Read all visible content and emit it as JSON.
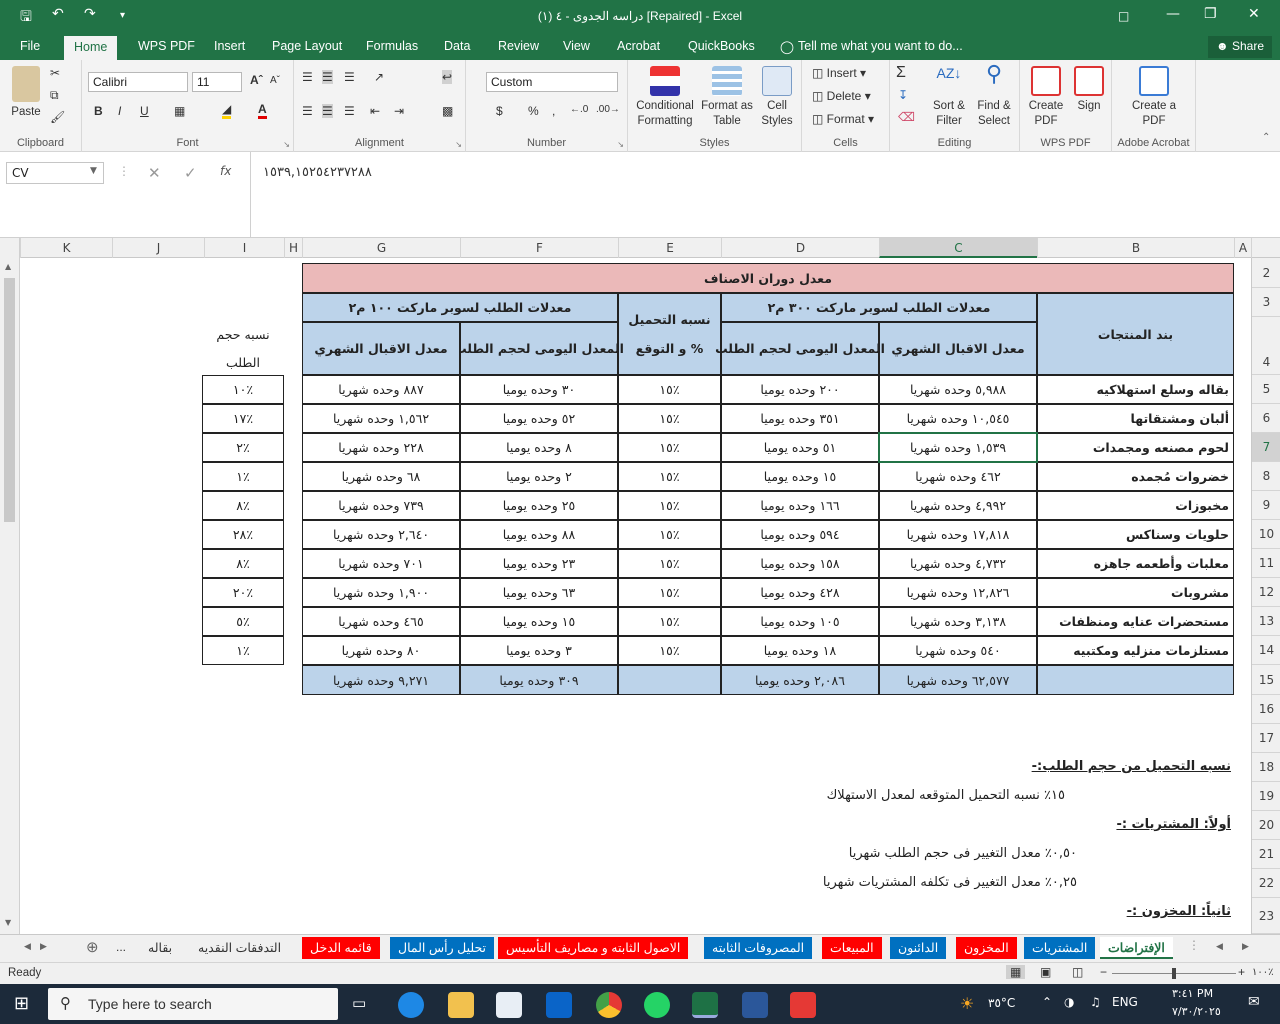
{
  "window": {
    "title": "دراسه الجدوى - ٤ (١) [Repaired] - Excel"
  },
  "menu": [
    "File",
    "Home",
    "WPS PDF",
    "Insert",
    "Page Layout",
    "Formulas",
    "Data",
    "Review",
    "View",
    "Acrobat",
    "QuickBooks",
    "Tell me what you want to do...",
    "Share"
  ],
  "ribbon": {
    "clipboard": {
      "paste": "Paste",
      "label": "Clipboard"
    },
    "font": {
      "name": "Calibri",
      "size": "11",
      "label": "Font"
    },
    "alignment": {
      "label": "Alignment"
    },
    "number": {
      "format": "Custom",
      "label": "Number"
    },
    "styles": {
      "conditional": "Conditional Formatting",
      "format_table": "Format as Table",
      "cell_styles": "Cell Styles",
      "label": "Styles"
    },
    "cells": {
      "insert": "Insert",
      "delete": "Delete",
      "format": "Format",
      "label": "Cells"
    },
    "editing": {
      "sort": "Sort & Filter",
      "find": "Find & Select",
      "label": "Editing"
    },
    "wpspdf": {
      "create": "Create PDF",
      "sign": "Sign",
      "label": "WPS PDF"
    },
    "acrobat": {
      "create": "Create a PDF",
      "label": "Adobe Acrobat"
    }
  },
  "formula_bar": {
    "name_box": "CV",
    "formula": "١٥٣٩,١٥٢٥٤٢٣٧٢٨٨"
  },
  "columns": [
    "K",
    "J",
    "I",
    "H",
    "G",
    "F",
    "E",
    "D",
    "C",
    "B",
    "A"
  ],
  "rows": [
    "2",
    "3",
    "4",
    "5",
    "6",
    "7",
    "8",
    "9",
    "10",
    "11",
    "12",
    "13",
    "14",
    "15",
    "16",
    "17",
    "18",
    "19",
    "20",
    "21",
    "22",
    "23"
  ],
  "table": {
    "title": "معدل دوران الاصناف",
    "group300": "معدلات الطلب لسوبر ماركت ٣٠٠ م٢",
    "group100": "معدلات الطلب لسوبر ماركت ١٠٠ م٢",
    "load_header": "نسبه التحميل و التوقع %",
    "products_header": "بند المنتجات",
    "monthly_header": "معدل الاقبال الشهري",
    "daily_header": "المعدل اليومى لحجم الطلب",
    "share_header": "نسبه حجم الطلب",
    "rows": [
      {
        "product": "بقاله وسلع استهلاكيه",
        "c": "٥,٩٨٨  وحده شهريا",
        "d": "٢٠٠  وحده يوميا",
        "e": "١٥٪",
        "f": "٣٠  وحده يوميا",
        "g": "٨٨٧  وحده شهريا",
        "i": "١٠٪"
      },
      {
        "product": "ألبان ومشتقاتها",
        "c": "١٠,٥٤٥  وحده شهريا",
        "d": "٣٥١  وحده يوميا",
        "e": "١٥٪",
        "f": "٥٢  وحده يوميا",
        "g": "١,٥٦٢  وحده شهريا",
        "i": "١٧٪"
      },
      {
        "product": "لحوم مصنعه ومجمدات",
        "c": "١,٥٣٩  وحده شهريا",
        "d": "٥١  وحده يوميا",
        "e": "١٥٪",
        "f": "٨  وحده يوميا",
        "g": "٢٢٨  وحده شهريا",
        "i": "٢٪"
      },
      {
        "product": "خضروات مُجمده",
        "c": "٤٦٢  وحده شهريا",
        "d": "١٥  وحده يوميا",
        "e": "١٥٪",
        "f": "٢  وحده يوميا",
        "g": "٦٨  وحده شهريا",
        "i": "١٪"
      },
      {
        "product": "مخبوزات",
        "c": "٤,٩٩٢  وحده شهريا",
        "d": "١٦٦  وحده يوميا",
        "e": "١٥٪",
        "f": "٢٥  وحده يوميا",
        "g": "٧٣٩  وحده شهريا",
        "i": "٨٪"
      },
      {
        "product": "حلويات وسناكس",
        "c": "١٧,٨١٨  وحده شهريا",
        "d": "٥٩٤  وحده يوميا",
        "e": "١٥٪",
        "f": "٨٨  وحده يوميا",
        "g": "٢,٦٤٠  وحده شهريا",
        "i": "٢٨٪"
      },
      {
        "product": "معلبات وأطعمه جاهزه",
        "c": "٤,٧٣٢  وحده شهريا",
        "d": "١٥٨  وحده يوميا",
        "e": "١٥٪",
        "f": "٢٣  وحده يوميا",
        "g": "٧٠١  وحده شهريا",
        "i": "٨٪"
      },
      {
        "product": "مشروبات",
        "c": "١٢,٨٢٦  وحده شهريا",
        "d": "٤٢٨  وحده يوميا",
        "e": "١٥٪",
        "f": "٦٣  وحده يوميا",
        "g": "١,٩٠٠  وحده شهريا",
        "i": "٢٠٪"
      },
      {
        "product": "مستحضرات عنايه ومنظفات",
        "c": "٣,١٣٨  وحده شهريا",
        "d": "١٠٥  وحده يوميا",
        "e": "١٥٪",
        "f": "١٥  وحده يوميا",
        "g": "٤٦٥  وحده شهريا",
        "i": "٥٪"
      },
      {
        "product": "مستلزمات منزليه ومكتبيه",
        "c": "٥٤٠  وحده شهريا",
        "d": "١٨  وحده يوميا",
        "e": "١٥٪",
        "f": "٣  وحده يوميا",
        "g": "٨٠  وحده شهريا",
        "i": "١٪"
      }
    ],
    "totals": {
      "c": "٦٢,٥٧٧  وحده شهريا",
      "d": "٢,٠٨٦  وحده يوميا",
      "f": "٣٠٩  وحده يوميا",
      "g": "٩,٢٧١  وحده شهريا"
    }
  },
  "notes": {
    "heading1": "نسبه التحميل من حجم الطلب:-",
    "line1": "١٥٪ نسبه التحميل المتوقعه لمعدل الاستهلاك",
    "heading2": "أولاً: المشتريات :-",
    "line2": "٠,٥٠٪  معدل التغيير فى حجم الطلب شهريا",
    "line3": "٠,٢٥٪  معدل التغيير فى تكلفه المشتريات شهريا",
    "heading3": "ثانياً: المخزون :-"
  },
  "sheet_tabs": [
    {
      "label": "الإفتراضات",
      "color": "#ffffff",
      "active": true
    },
    {
      "label": "المشتريات",
      "color": "#0070c0"
    },
    {
      "label": "المخزون",
      "color": "#ff0000"
    },
    {
      "label": "الدائنون",
      "color": "#0070c0"
    },
    {
      "label": "المبيعات",
      "color": "#ff0000"
    },
    {
      "label": "المصروفات الثابته",
      "color": "#0070c0"
    },
    {
      "label": "الاصول الثابته و مصاريف التأسيس",
      "color": "#ff0000"
    },
    {
      "label": "تحليل رأس المال",
      "color": "#0070c0"
    },
    {
      "label": "قائمه الدخل",
      "color": "#ff0000"
    },
    {
      "label": "التدفقات النقديه",
      "color": "none"
    },
    {
      "label": "بقاله",
      "color": "none"
    }
  ],
  "status": {
    "ready": "Ready",
    "zoom": "١٠٠٪"
  },
  "taskbar": {
    "search_placeholder": "Type here to search",
    "temp": "٣٥°C",
    "lang": "ENG",
    "time": "٣:٤١ PM",
    "date": "٧/٣٠/٢٠٢٥"
  },
  "accent": "#217346"
}
